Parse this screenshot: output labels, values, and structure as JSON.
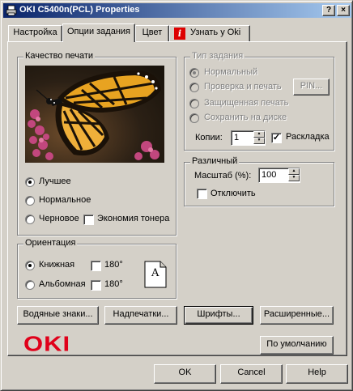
{
  "window": {
    "title": "OKI C5400n(PCL) Properties",
    "help_glyph": "?",
    "close_glyph": "×"
  },
  "tabs": [
    {
      "label": "Настройка",
      "active": false
    },
    {
      "label": "Опции задания",
      "active": true
    },
    {
      "label": "Цвет",
      "active": false
    },
    {
      "label": "Узнать у Oki",
      "active": false
    }
  ],
  "print_quality": {
    "title": "Качество печати",
    "options": [
      {
        "label": "Лучшее",
        "selected": true
      },
      {
        "label": "Нормальное",
        "selected": false
      },
      {
        "label": "Черновое",
        "selected": false
      }
    ],
    "toner_saving": {
      "label": "Экономия тонера",
      "checked": false
    }
  },
  "job_type": {
    "title": "Тип задания",
    "options": [
      {
        "label": "Нормальный",
        "selected": true
      },
      {
        "label": "Проверка и печать",
        "selected": false
      },
      {
        "label": "Защищенная печать",
        "selected": false
      },
      {
        "label": "Сохранить на диске",
        "selected": false
      }
    ],
    "pin_button": "PIN...",
    "copies_label": "Копии:",
    "copies_value": "1",
    "collate": {
      "label": "Раскладка",
      "checked": true
    }
  },
  "misc": {
    "title": "Различный",
    "scale_label": "Масштаб (%):",
    "scale_value": "100",
    "disable": {
      "label": "Отключить",
      "checked": false
    }
  },
  "orientation": {
    "title": "Ориентация",
    "portrait": {
      "label": "Книжная",
      "selected": true
    },
    "landscape": {
      "label": "Альбомная",
      "selected": false
    },
    "rotate_portrait": {
      "label": "180°",
      "checked": false
    },
    "rotate_landscape": {
      "label": "180°",
      "checked": false
    },
    "icon_letter": "A"
  },
  "buttons": {
    "watermarks": "Водяные знаки...",
    "overlays": "Надпечатки...",
    "fonts": "Шрифты...",
    "advanced": "Расширенные...",
    "defaults": "По умолчанию",
    "ok": "OK",
    "cancel": "Cancel",
    "help": "Help"
  },
  "logo": {
    "text": "OKI",
    "color": "#e0001a"
  },
  "colors": {
    "accent": "#0a246a",
    "face": "#d4d0c8"
  }
}
